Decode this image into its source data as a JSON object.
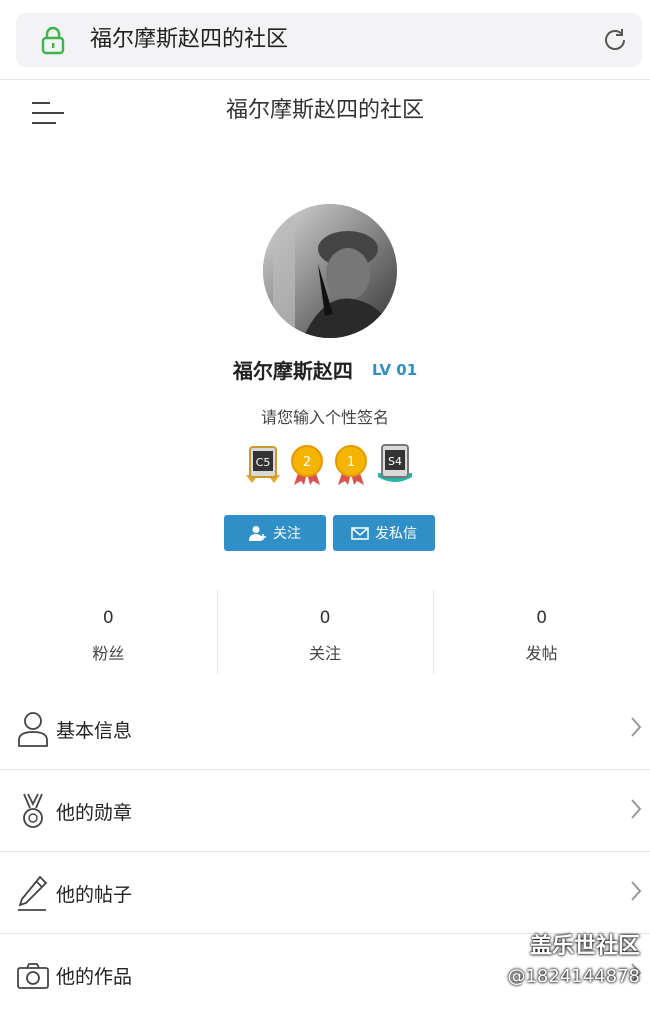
{
  "address_bar": {
    "url_text": "福尔摩斯赵四的社区"
  },
  "header": {
    "title": "福尔摩斯赵四的社区"
  },
  "profile": {
    "username": "福尔摩斯赵四",
    "level": "LV 01",
    "signature": "请您输入个性签名",
    "badges": [
      {
        "label": "C5"
      },
      {
        "label": "2"
      },
      {
        "label": "1"
      },
      {
        "label": "S4"
      }
    ]
  },
  "buttons": {
    "follow": "关注",
    "message": "发私信"
  },
  "stats": [
    {
      "value": "0",
      "label": "粉丝"
    },
    {
      "value": "0",
      "label": "关注"
    },
    {
      "value": "0",
      "label": "发帖"
    }
  ],
  "menu": [
    {
      "label": "基本信息",
      "icon": "user-icon"
    },
    {
      "label": "他的勋章",
      "icon": "medal-icon"
    },
    {
      "label": "他的帖子",
      "icon": "pencil-icon"
    },
    {
      "label": "他的作品",
      "icon": "camera-icon"
    }
  ],
  "watermark": {
    "line1": "盖乐世社区",
    "line2": "@1824144878"
  },
  "colors": {
    "accent": "#2f8fc6",
    "lock": "#3bb54a"
  }
}
